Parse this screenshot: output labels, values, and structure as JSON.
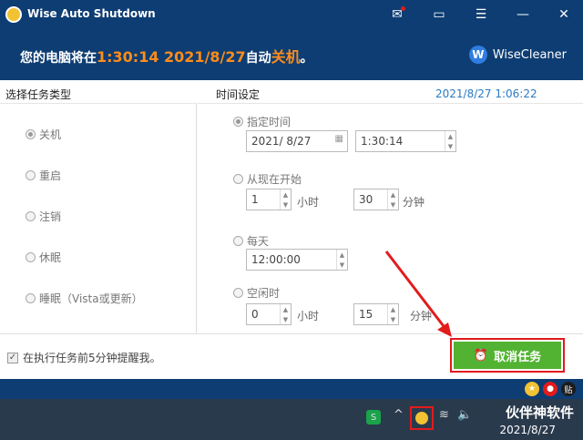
{
  "window": {
    "title": "Wise Auto Shutdown",
    "buttons": [
      "mail-icon",
      "chat-icon",
      "menu-icon",
      "minimize-icon",
      "close-icon"
    ]
  },
  "banner": {
    "prefix": "您的电脑将在",
    "time": "1:30:14 2021/8/27",
    "middle": "自动",
    "action": "关机",
    "suffix": "。",
    "brand": "WiseCleaner",
    "brand_letter": "W"
  },
  "left": {
    "header": "选择任务类型",
    "options": [
      "关机",
      "重启",
      "注销",
      "休眠",
      "睡眠（Vista或更新）"
    ],
    "selected": 0
  },
  "right": {
    "header": "时间设定",
    "current_datetime": "2021/8/27 1:06:22",
    "specific": {
      "label": "指定时间",
      "date": "2021/  8/27",
      "time": "1:30:14"
    },
    "from_now": {
      "label": "从现在开始",
      "hours": "1",
      "hours_unit": "小时",
      "minutes": "30",
      "minutes_unit": "分钟"
    },
    "daily": {
      "label": "每天",
      "time": "12:00:00"
    },
    "idle": {
      "label": "空闲时",
      "hours": "0",
      "hours_unit": "小时",
      "minutes": "15",
      "minutes_unit": "分钟"
    }
  },
  "bottom": {
    "remind": "在执行任务前5分钟提醒我。",
    "remind_checked": true,
    "cancel_button": "取消任务"
  },
  "taskbar": {
    "watermark": "伙伴神软件",
    "date": "2021/8/27"
  },
  "colors": {
    "accent": "#ff8c1a",
    "header_bg": "#0d3d73",
    "button_green": "#52b332",
    "highlight_red": "#e21b1b"
  }
}
